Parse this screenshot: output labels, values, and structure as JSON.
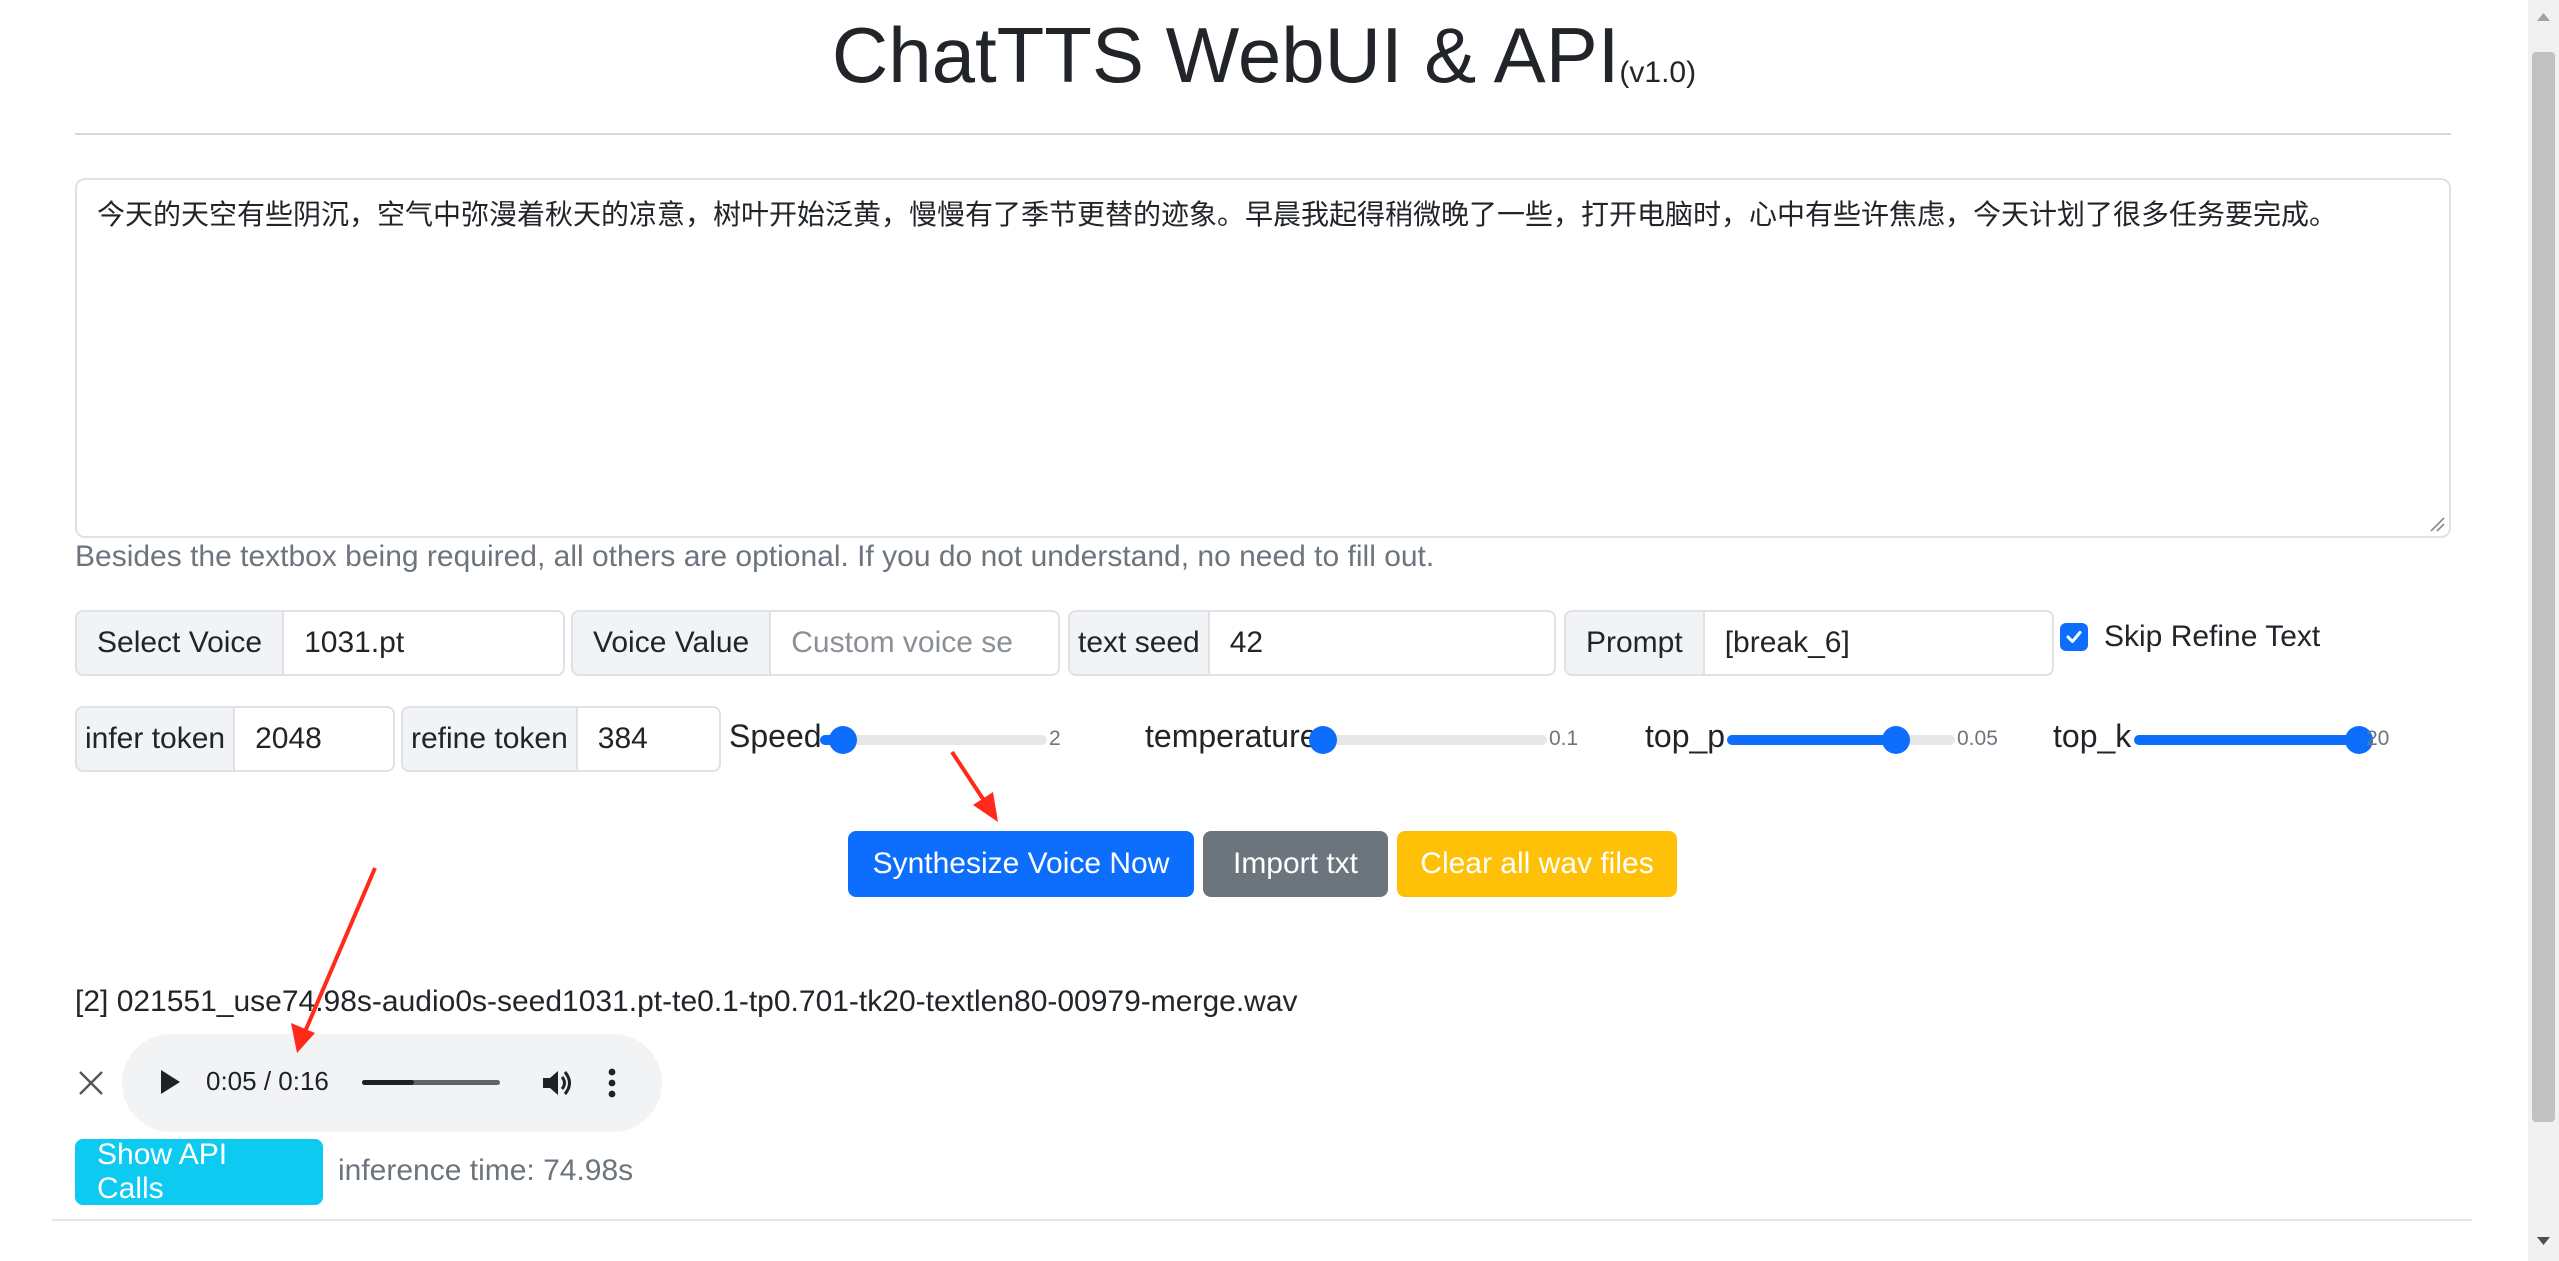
{
  "header": {
    "title": "ChatTTS WebUI & API",
    "version": "(v1.0)"
  },
  "textbox": {
    "value": "今天的天空有些阴沉，空气中弥漫着秋天的凉意，树叶开始泛黄，慢慢有了季节更替的迹象。早晨我起得稍微晚了一些，打开电脑时，心中有些许焦虑，今天计划了很多任务要完成。"
  },
  "help_text": "Besides the textbox being required, all others are optional. If you do not understand, no need to fill out.",
  "row1": {
    "select_voice": {
      "label": "Select Voice",
      "value": "1031.pt"
    },
    "voice_value": {
      "label": "Voice Value",
      "placeholder": "Custom voice se"
    },
    "text_seed": {
      "label": "text seed",
      "value": "42"
    },
    "prompt": {
      "label": "Prompt",
      "value": "[break_6]"
    },
    "skip_refine": {
      "label": "Skip Refine Text",
      "checked": true
    }
  },
  "row2": {
    "infer_token": {
      "label": "infer token",
      "value": "2048"
    },
    "refine_token": {
      "label": "refine token",
      "value": "384"
    },
    "sliders": {
      "speed": {
        "label": "Speed",
        "value_text": "2",
        "level": 0.1
      },
      "temperature": {
        "label": "temperature",
        "value_text": "0.1",
        "level": 0.04
      },
      "top_p": {
        "label": "top_p",
        "value_text": "0.05",
        "level": 0.74
      },
      "top_k": {
        "label": "top_k",
        "value_text": "20",
        "level": 0.98
      }
    }
  },
  "buttons": {
    "synthesize": "Synthesize Voice Now",
    "import_txt": "Import txt",
    "clear_wav": "Clear all wav files",
    "show_api": "Show API Calls"
  },
  "result": {
    "file_name": "[2] 021551_use74.98s-audio0s-seed1031.pt-te0.1-tp0.701-tk20-textlen80-00979-merge.wav",
    "player": {
      "current": "0:05",
      "duration": "0:16",
      "time_text": "0:05 / 0:16",
      "progress": 0.38
    },
    "inference_time": "inference time: 74.98s"
  },
  "colors": {
    "primary": "#0d6efd",
    "secondary": "#6c757d",
    "warning": "#ffc107",
    "info": "#0dcaf0",
    "annotation_arrow": "#ff2a1a"
  }
}
